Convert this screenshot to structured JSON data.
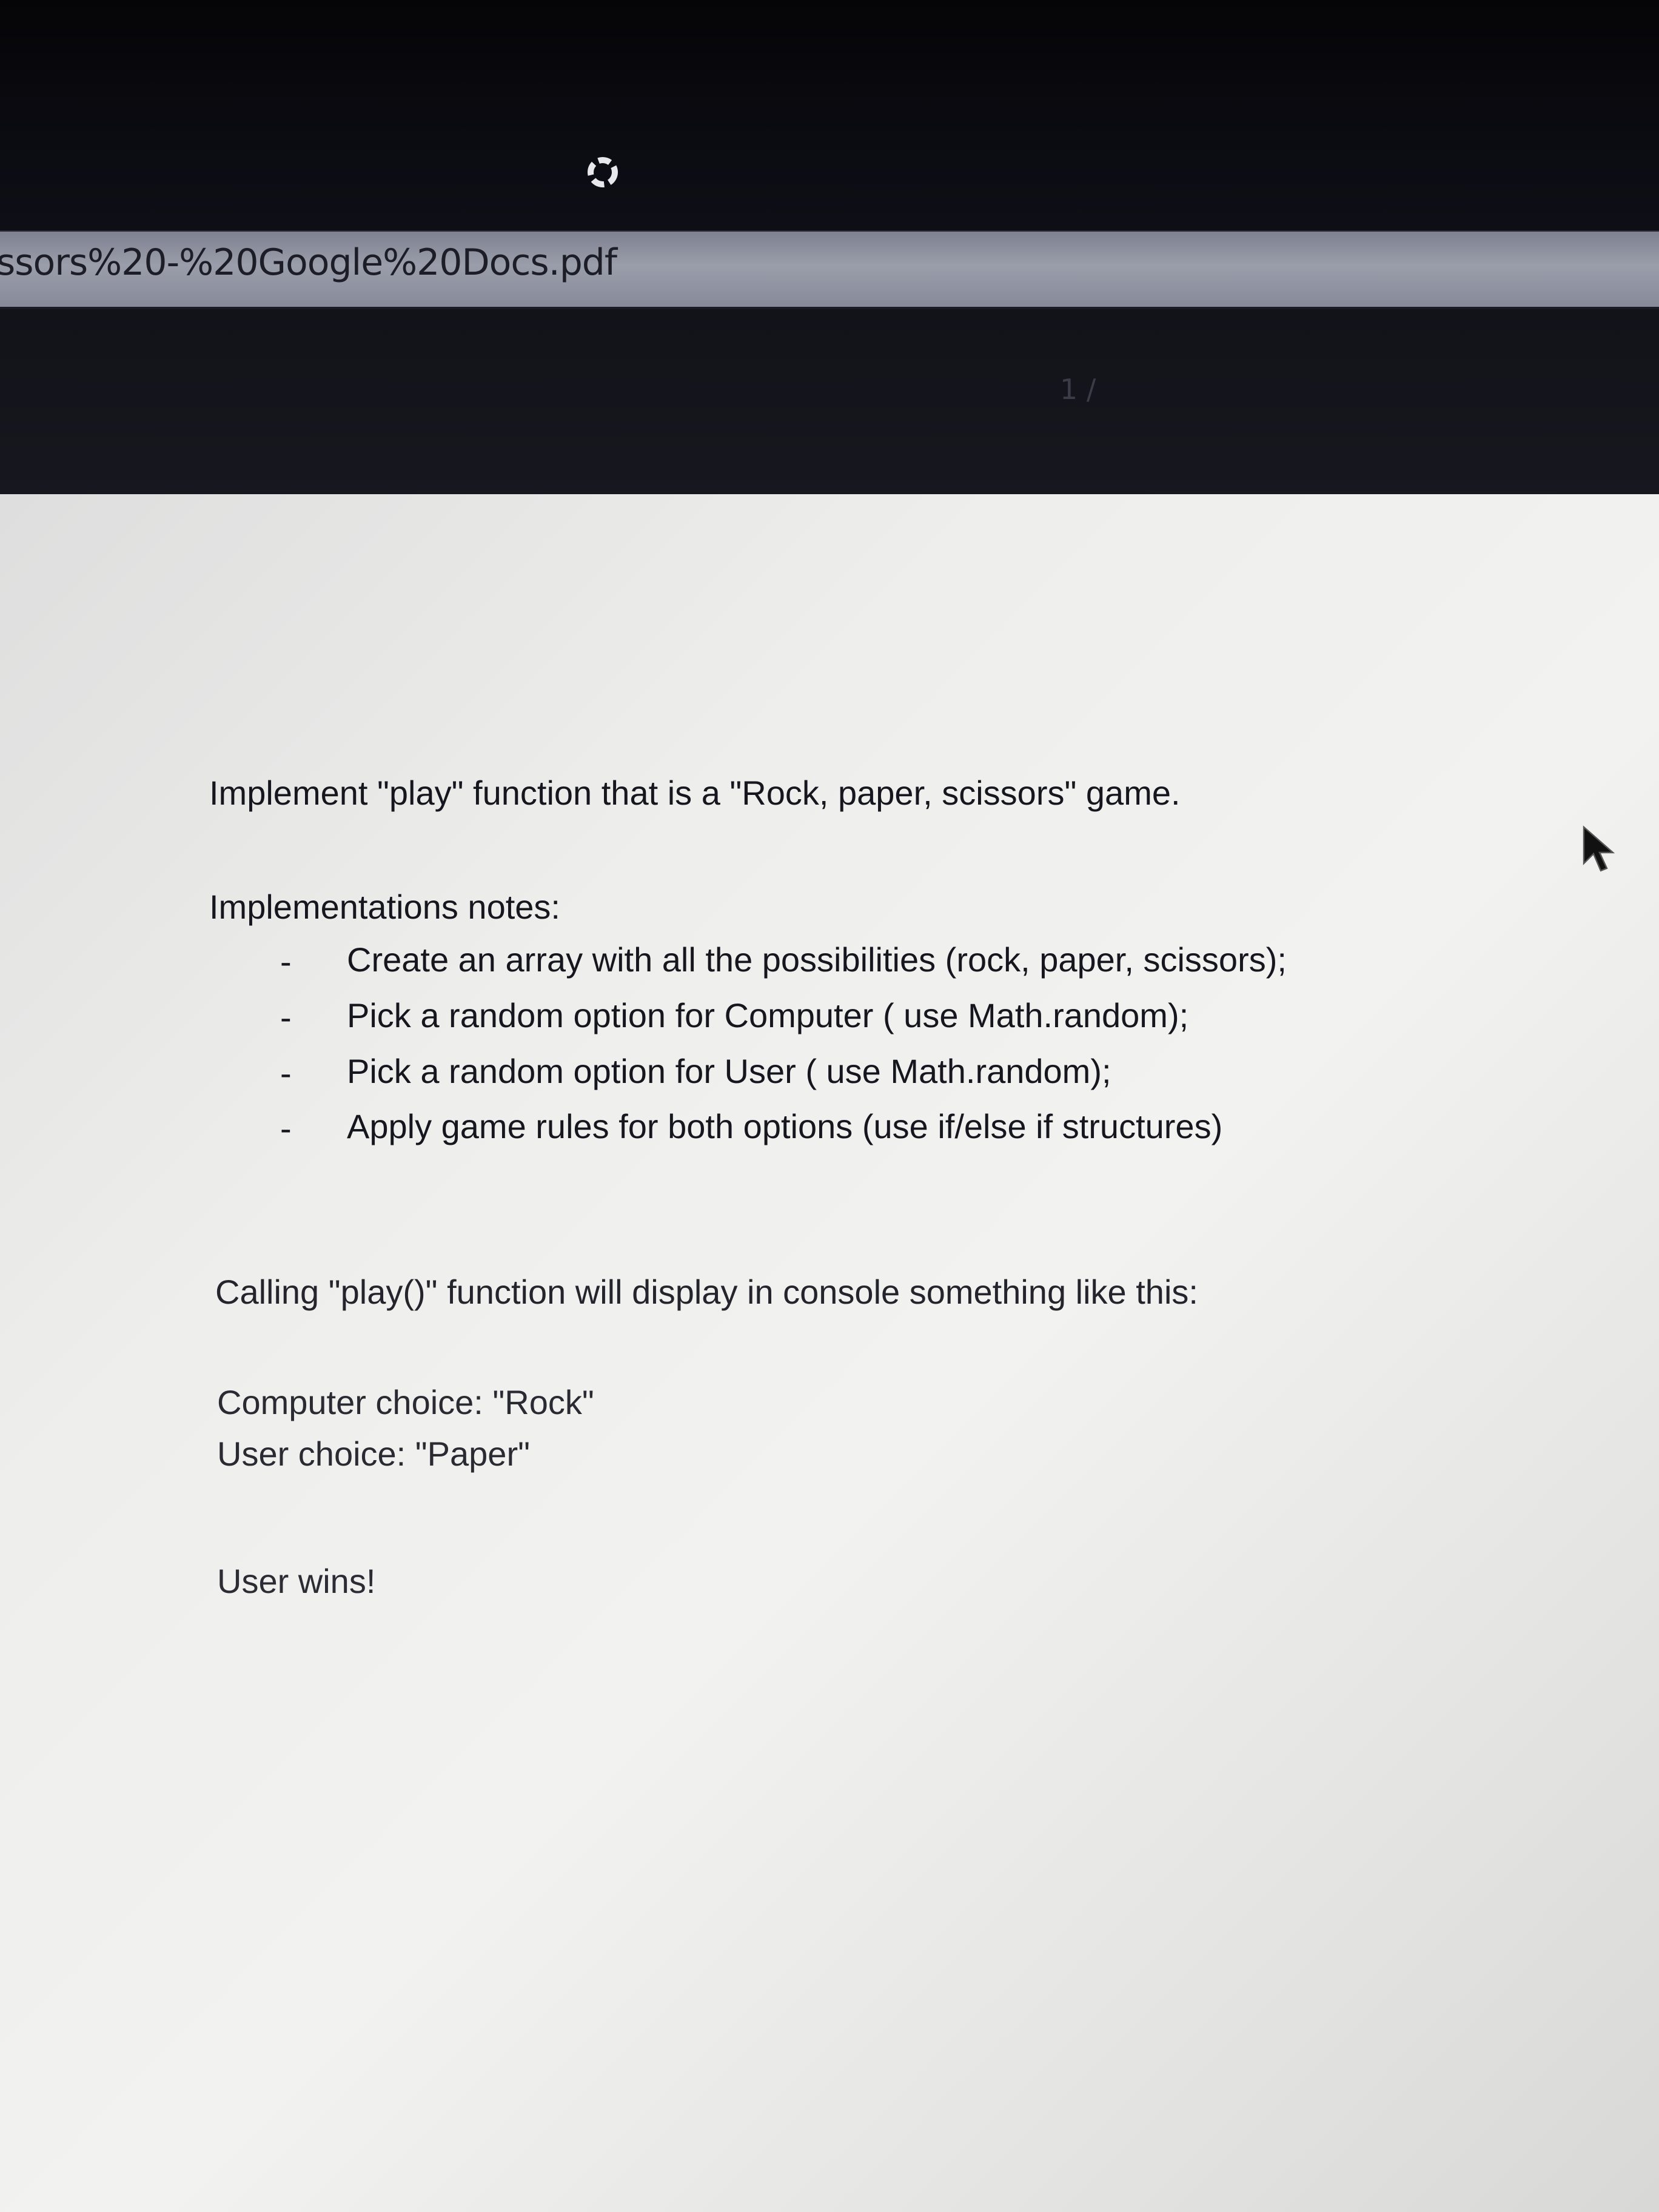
{
  "viewer": {
    "address_text": "ssors%20-%20Google%20Docs.pdf",
    "page_indicator": "1 /"
  },
  "document": {
    "heading": "Implement \"play\" function that is a \"Rock, paper, scissors\" game.",
    "notes_title": "Implementations notes:",
    "notes": [
      "Create an array with all the possibilities (rock, paper, scissors);",
      "Pick a random option for Computer ( use Math.random);",
      "Pick a random option for User ( use Math.random);",
      "Apply game rules for both options (use if/else if structures)"
    ],
    "bullet_marker": "-",
    "calling_text": "Calling \"play()\" function will display in console something like this:",
    "example_output": [
      "Computer choice: \"Rock\"",
      "User choice: \"Paper\""
    ],
    "result_text": "User wins!"
  },
  "icons": {
    "loading": "loading-spinner-icon",
    "cursor": "mouse-pointer-icon"
  }
}
